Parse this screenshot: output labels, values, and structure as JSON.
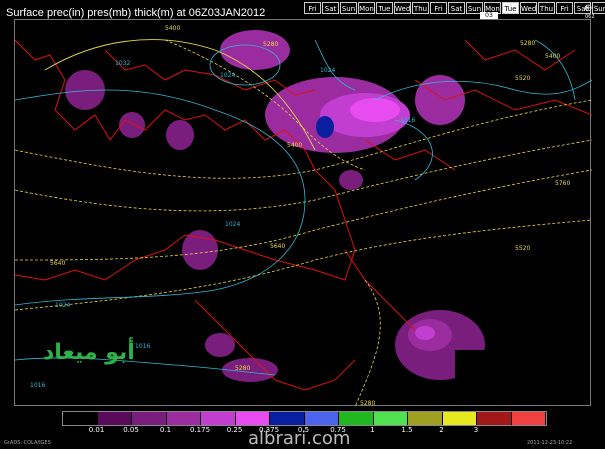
{
  "title": "Surface prec(in) pres(mb) thick(m) at 06Z03JAN2012",
  "day_strip": {
    "days": [
      "Fri",
      "Sat",
      "Sun",
      "Mon",
      "Tue",
      "Wed",
      "Thu",
      "Fri",
      "Sat",
      "Sun",
      "Mon",
      "Tue",
      "Wed",
      "Thu",
      "Fri",
      "Sat",
      "Sun"
    ],
    "active_index": 11,
    "active_sub": "03"
  },
  "logo": {
    "symbol": "⊕",
    "sub": "062"
  },
  "watermark": "أبو ميعاد",
  "site_mark": "albrari.com",
  "colorbar": {
    "colors": [
      "#000000",
      "#5a0a5a",
      "#7a1e7e",
      "#9a2ca0",
      "#c23ed0",
      "#e84cf0",
      "#0a1ea0",
      "#4a64ee",
      "#20b820",
      "#50e050",
      "#a0a020",
      "#e8e820",
      "#a01818",
      "#f04040"
    ],
    "labels": [
      "0.01",
      "0.05",
      "0.1",
      "0.175",
      "0.25",
      "0.375",
      "0.5",
      "0.75",
      "1",
      "1.5",
      "2",
      "3"
    ]
  },
  "contour_labels": [
    "5400",
    "5280",
    "1032",
    "1024",
    "1024",
    "5400",
    "1016",
    "5280",
    "5400",
    "5520",
    "5760",
    "5520",
    "1024",
    "5640",
    "5640",
    "1024",
    "1016",
    "1016",
    "5280",
    "5280"
  ],
  "credit": "GrADS: COLA/IGES",
  "timestamp": "2011-12-23-10:22"
}
